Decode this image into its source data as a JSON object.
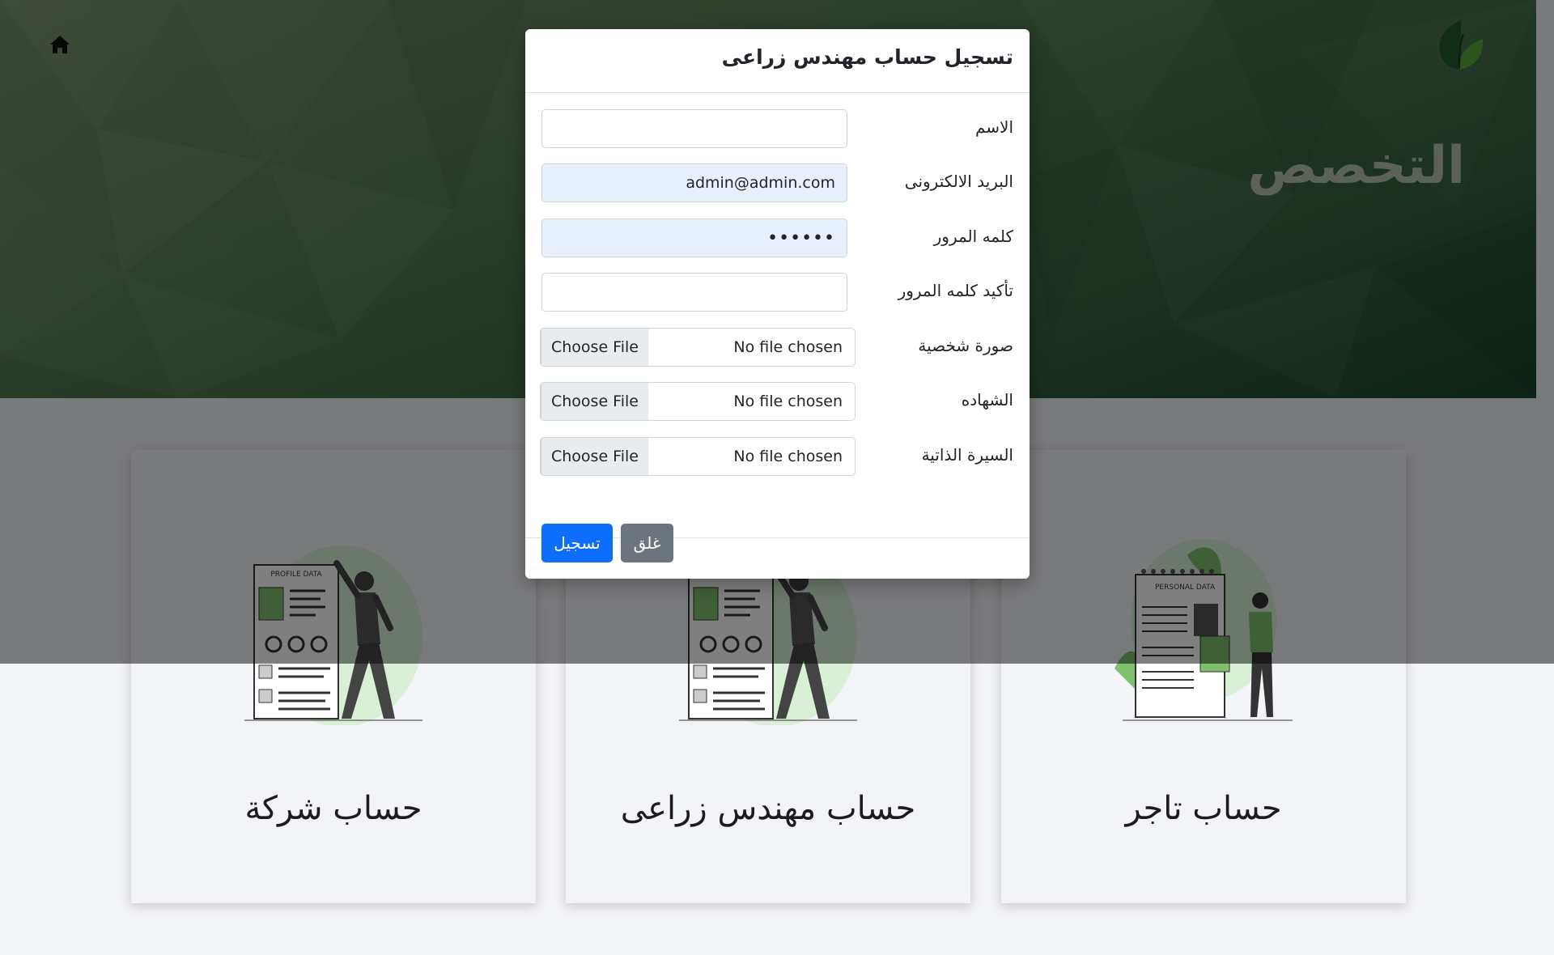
{
  "header": {
    "home_icon": "home-icon",
    "logo_icon": "leaf-logo",
    "title": "التخصص"
  },
  "cards": [
    {
      "title": "حساب شركة",
      "illustration": "profile-data-illustration"
    },
    {
      "title": "حساب مهندس زراعى",
      "illustration": "profile-data-illustration"
    },
    {
      "title": "حساب تاجر",
      "illustration": "personal-data-illustration"
    }
  ],
  "modal": {
    "title": "تسجيل حساب مهندس زراعى",
    "fields": [
      {
        "label": "الاسم",
        "value": ""
      },
      {
        "label": "البريد الالكترونى",
        "value": "admin@admin.com"
      },
      {
        "label": "كلمه المرور",
        "value": "••••••"
      },
      {
        "label": "تأكيد كلمه المرور",
        "value": ""
      },
      {
        "label": "صورة شخصية",
        "button": "Choose File",
        "file_text": "No file chosen"
      },
      {
        "label": "الشهاده",
        "button": "Choose File",
        "file_text": "No file chosen"
      },
      {
        "label": "السيرة الذاتية",
        "button": "Choose File",
        "file_text": "No file chosen"
      }
    ],
    "submit_label": "تسجيل",
    "close_label": "غلق"
  },
  "colors": {
    "primary": "#0d6efd",
    "secondary": "#6c757d",
    "autofill": "#e8f0fe"
  }
}
